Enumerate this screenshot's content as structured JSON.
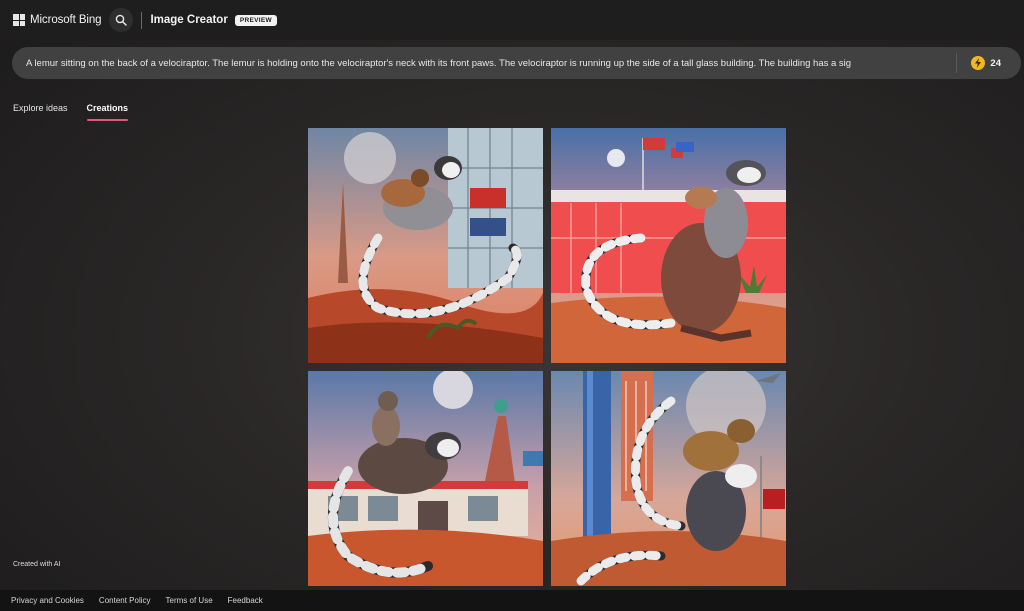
{
  "header": {
    "brand": "Microsoft Bing",
    "app_title": "Image Creator",
    "badge": "PREVIEW",
    "icons": {
      "logo": "microsoft-logo",
      "search": "search-icon"
    }
  },
  "prompt": {
    "value": "A lemur sitting on the back of a velociraptor. The lemur is holding onto the velociraptor's neck with its front paws. The velociraptor is running up the side of a tall glass building. The building has a sig",
    "boost_count": "24",
    "boost_icon": "lightning-bolt-icon"
  },
  "tabs": [
    {
      "label": "Explore ideas",
      "active": false
    },
    {
      "label": "Creations",
      "active": true
    }
  ],
  "images_count": 4,
  "created_with_ai": "Created with AI",
  "footer": {
    "links": [
      "Privacy and Cookies",
      "Content Policy",
      "Terms of Use",
      "Feedback"
    ]
  },
  "colors": {
    "accent_underline": "#e2557d",
    "boost_coin": "#f3b81e"
  }
}
